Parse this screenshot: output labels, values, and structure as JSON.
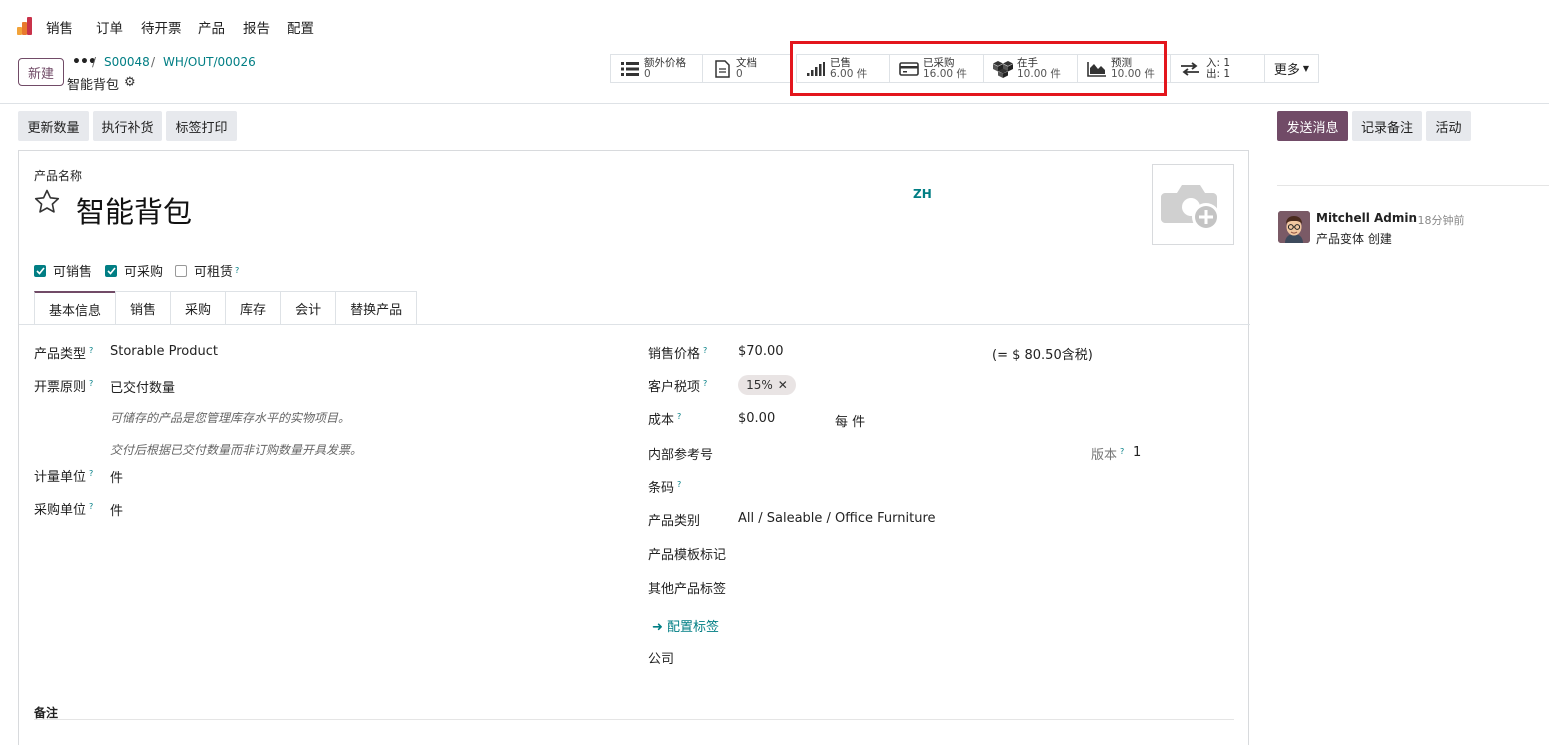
{
  "nav": {
    "items": [
      "销售",
      "订单",
      "待开票",
      "产品",
      "报告",
      "配置"
    ]
  },
  "control": {
    "new_label": "新建",
    "breadcrumb_dots": "•••",
    "breadcrumbs": [
      "S00048",
      "WH/OUT/00026"
    ],
    "record_title": "智能背包",
    "smart_buttons": [
      {
        "label": "额外价格",
        "value": "0"
      },
      {
        "label": "文档",
        "value": "0"
      },
      {
        "label": "已售",
        "value": "6.00 件"
      },
      {
        "label": "已采购",
        "value": "16.00 件"
      },
      {
        "label": "在手",
        "value": "10.00 件"
      },
      {
        "label": "预测",
        "value": "10.00 件"
      },
      {
        "label": "入:",
        "value": "1"
      },
      {
        "label": "出:",
        "value": "1"
      }
    ],
    "more_label": "更多"
  },
  "actions": {
    "update_qty": "更新数量",
    "replenish": "执行补货",
    "print_labels": "标签打印"
  },
  "chatter_actions": {
    "send_message": "发送消息",
    "log_note": "记录备注",
    "activity": "活动"
  },
  "form": {
    "name_label": "产品名称",
    "name": "智能背包",
    "lang": "ZH",
    "checks": [
      {
        "label": "可销售",
        "checked": true
      },
      {
        "label": "可采购",
        "checked": true
      },
      {
        "label": "可租赁",
        "checked": false
      }
    ],
    "tabs": [
      "基本信息",
      "销售",
      "采购",
      "库存",
      "会计",
      "替换产品"
    ],
    "left": {
      "type_label": "产品类型",
      "type_value": "Storable Product",
      "invoice_label": "开票原则",
      "invoice_value": "已交付数量",
      "help1": "可储存的产品是您管理库存水平的实物项目。",
      "help2": "交付后根据已交付数量而非订购数量开具发票。",
      "uom_label": "计量单位",
      "uom_value": "件",
      "po_uom_label": "采购单位",
      "po_uom_value": "件"
    },
    "right": {
      "price_label": "销售价格",
      "price_value": "$70.00",
      "price_incl": "(= $ 80.50含税)",
      "tax_label": "客户税项",
      "tax_value": "15%",
      "cost_label": "成本",
      "cost_value": "$0.00",
      "cost_per": "每 件",
      "ref_label": "内部参考号",
      "version_label": "版本",
      "version_value": "1",
      "barcode_label": "条码",
      "categ_label": "产品类别",
      "categ_value": "All / Saleable / Office Furniture",
      "tmpl_tags_label": "产品模板标记",
      "other_tags_label": "其他产品标签",
      "config_tags": "配置标签",
      "company_label": "公司"
    },
    "notes_label": "备注"
  },
  "chatter": {
    "author": "Mitchell Admin",
    "ago": "- 18分钟前",
    "message": "产品变体 创建"
  },
  "colors": {
    "brand": "#714B67",
    "link": "#017e84",
    "highlight": "#e3161d"
  }
}
